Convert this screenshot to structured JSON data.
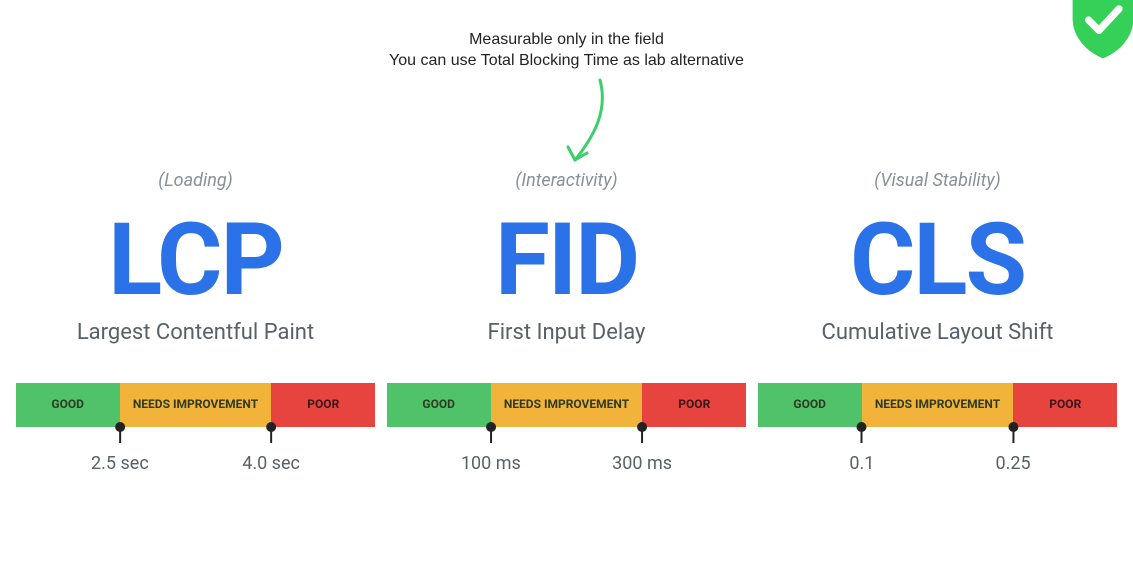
{
  "annotation": {
    "line1": "Measurable only in the field",
    "line2": "You can use Total Blocking Time as lab alternative"
  },
  "bar_labels": {
    "good": "GOOD",
    "needs": "NEEDS IMPROVEMENT",
    "poor": "POOR"
  },
  "metrics": [
    {
      "category": "(Loading)",
      "acronym": "LCP",
      "fullname": "Largest Contentful Paint",
      "threshold_low": "2.5 sec",
      "threshold_high": "4.0 sec"
    },
    {
      "category": "(Interactivity)",
      "acronym": "FID",
      "fullname": "First Input Delay",
      "threshold_low": "100 ms",
      "threshold_high": "300 ms"
    },
    {
      "category": "(Visual Stability)",
      "acronym": "CLS",
      "fullname": "Cumulative Layout Shift",
      "threshold_low": "0.1",
      "threshold_high": "0.25"
    }
  ],
  "colors": {
    "accent_blue": "#2b72e8",
    "good": "#4fc26a",
    "needs": "#f2b33a",
    "poor": "#e8443f"
  }
}
